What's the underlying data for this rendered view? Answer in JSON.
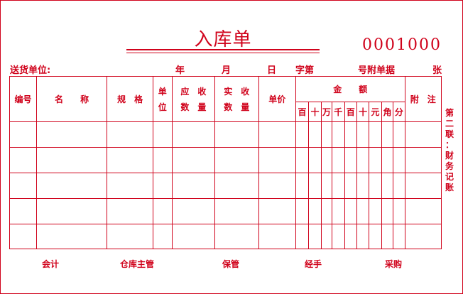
{
  "form": {
    "title": "入库单",
    "serial": "0001000",
    "header": {
      "supplier_label": "送货单位:",
      "year": "年",
      "month": "月",
      "day": "日",
      "zi_di": "字第",
      "hao_attached": "号附单据",
      "sheets": "张"
    },
    "columns": {
      "code": "编号",
      "name": "名　　称",
      "spec": "规　格",
      "unit": "单\n位",
      "qty_due": "应　收\n数　量",
      "qty_recv": "实　收\n数　量",
      "price": "单价",
      "amount": "金　　额",
      "note": "附　注",
      "digits": [
        "百",
        "十",
        "万",
        "千",
        "百",
        "十",
        "元",
        "角",
        "分"
      ]
    },
    "side_note": [
      "第",
      "二",
      "联",
      "：",
      "财",
      "务",
      "记",
      "账"
    ],
    "footer": {
      "accountant": "会计",
      "warehouse_manager": "仓库主管",
      "keeper": "保管",
      "handler": "经手",
      "purchaser": "采购"
    },
    "colors": {
      "ink": "#d0021b"
    }
  }
}
